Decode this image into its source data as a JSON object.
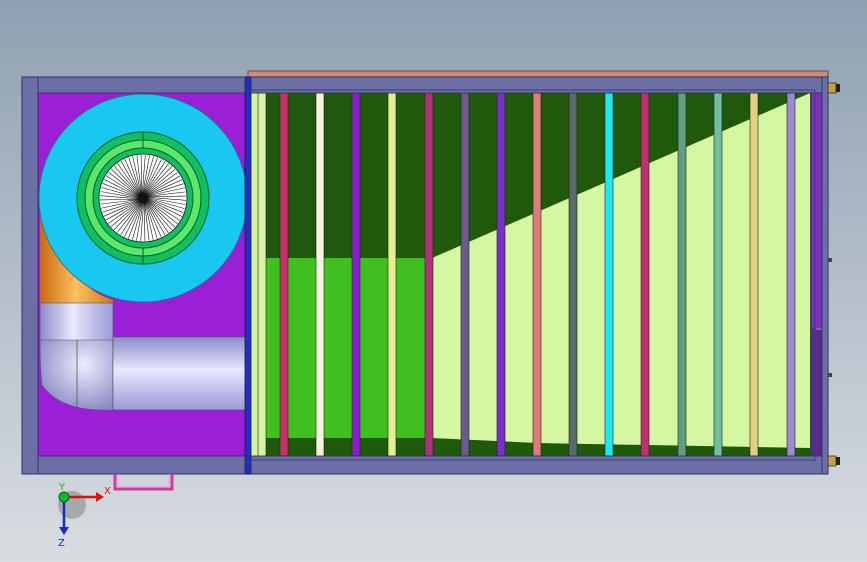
{
  "viewport": {
    "background_top": "#8fa0b2",
    "background_bottom": "#d9dde2"
  },
  "model": {
    "frame_color": "#6b6fa6",
    "frame_dark": "#3c3f6e",
    "top_rail_color": "#d08a78",
    "chamber_color": "#9a1fd6",
    "fan_housing_color": "#19c8f0",
    "fan_ring_color": "#10c060",
    "fan_inner_color": "#5be86a",
    "pipe_color": "#b4b4e6",
    "elbow_color": "#e08a20",
    "dark_green": "#1f5a0c",
    "mid_green": "#3fc01e",
    "light_green": "#d6f7a2",
    "divider_color": "#2330b8",
    "handle_color": "#d13aa0",
    "bar_colors": [
      "#d4f5a0",
      "#c8306a",
      "#f4f4e0",
      "#8a1fd0",
      "#e6f090",
      "#b0307a",
      "#6b5a8a",
      "#7a30c8",
      "#e07a7a",
      "#5a6a6a",
      "#20e8f0",
      "#c03070",
      "#60a080",
      "#70c0a0",
      "#e0d080",
      "#9a8ad0"
    ]
  },
  "triad": {
    "x_label": "X",
    "y_label": "Y",
    "z_label": "Z"
  }
}
